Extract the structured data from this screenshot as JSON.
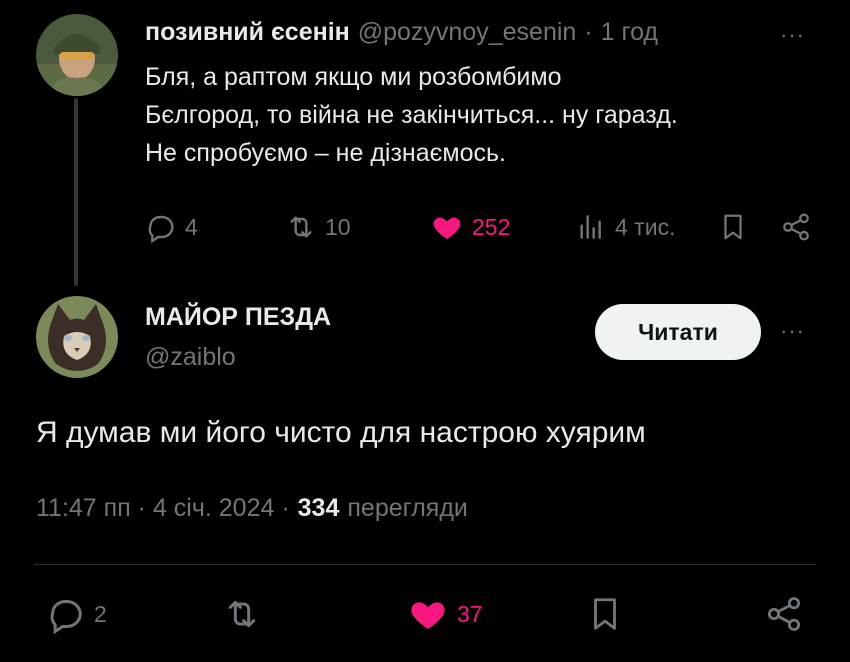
{
  "colors": {
    "like": "#f91880",
    "text": "#e7e9ea",
    "muted": "#71767b",
    "bg": "#000000"
  },
  "parent_tweet": {
    "display_name": "позивний єсенін",
    "handle": "@pozyvnoy_esenin",
    "separator": "·",
    "time": "1 год",
    "more_label": "···",
    "text_lines": [
      "Бля, а раптом якщо ми розбомбимо",
      "Бєлгород, то війна не закінчиться... ну гаразд.",
      "Не спробуємо – не дізнаємось."
    ],
    "actions": {
      "replies": "4",
      "reposts": "10",
      "likes": "252",
      "views": "4 тис."
    },
    "icons": [
      "reply-icon",
      "repost-icon",
      "like-icon",
      "views-icon",
      "bookmark-icon",
      "share-icon"
    ]
  },
  "main_tweet": {
    "display_name": "МАЙОР ПЕЗДА",
    "handle": "@zaiblo",
    "follow_label": "Читати",
    "more_label": "···",
    "text": "Я думав ми його чисто для настрою хуярим",
    "timestamp": "11:47 пп · 4 січ. 2024 ·",
    "views_count": "334",
    "views_label": "перегляди",
    "actions": {
      "replies": "2",
      "likes": "37"
    },
    "icons": [
      "reply-icon",
      "repost-icon",
      "like-icon",
      "bookmark-icon",
      "share-icon"
    ]
  }
}
